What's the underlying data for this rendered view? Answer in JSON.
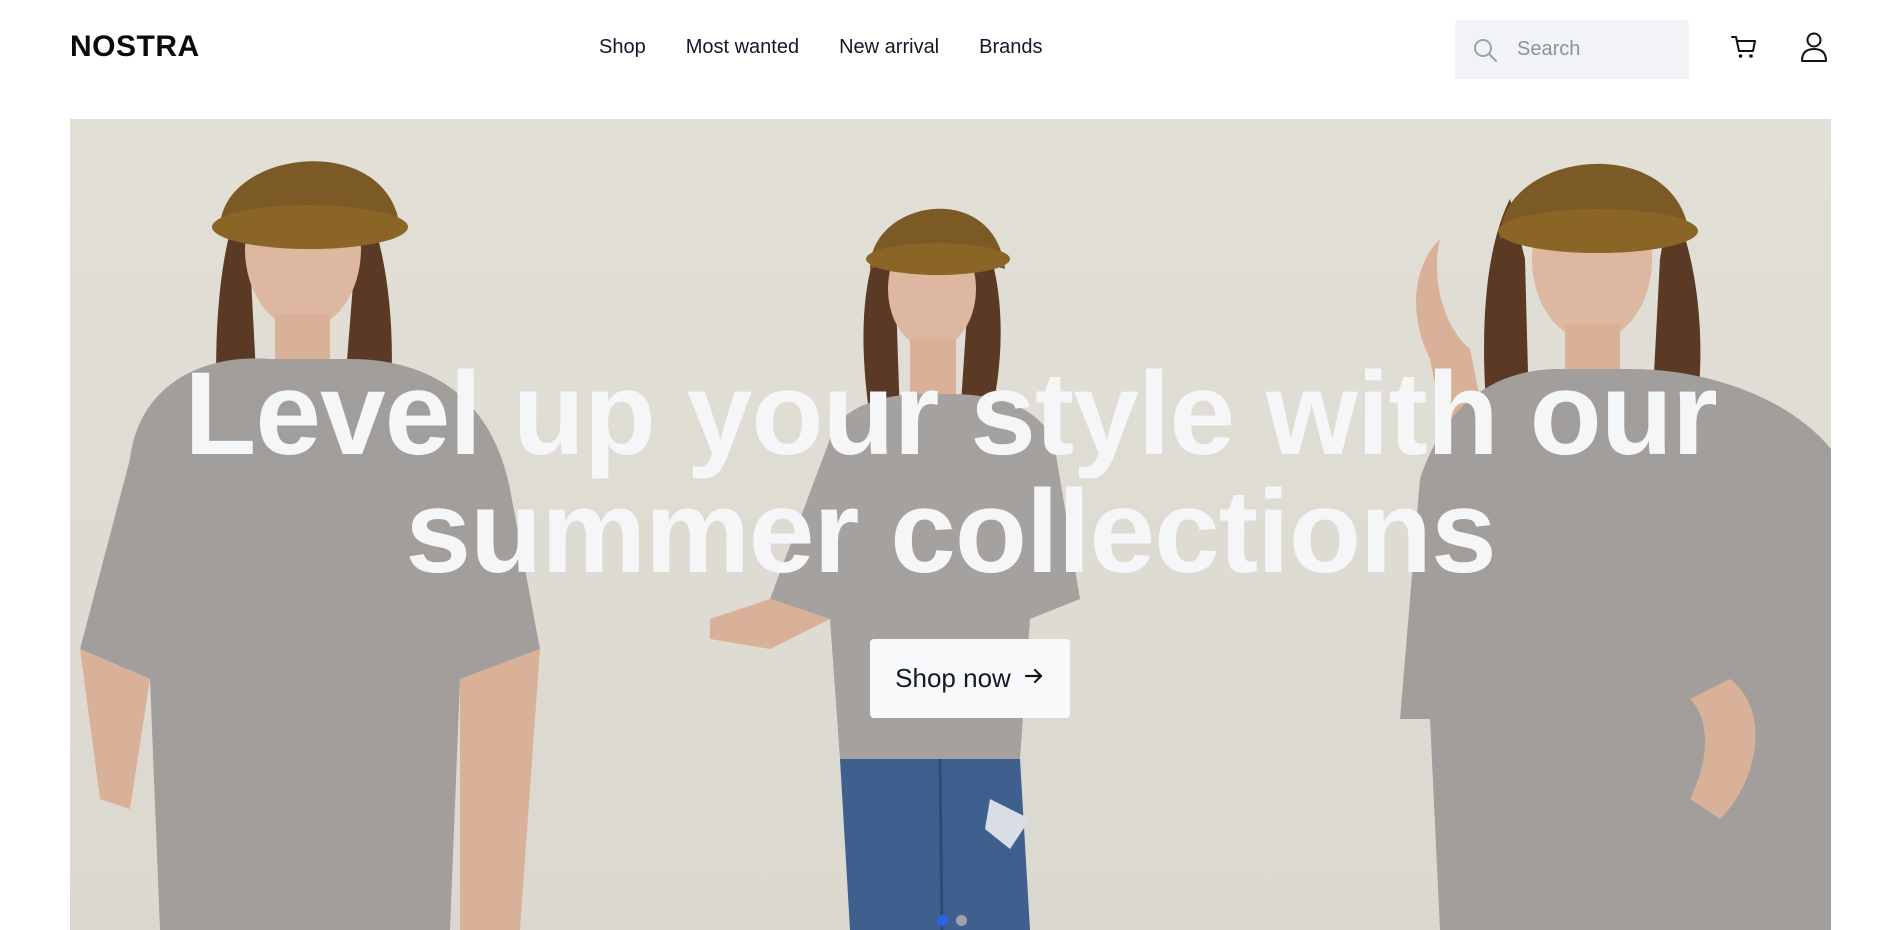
{
  "header": {
    "logo": "NOSTRA",
    "nav": [
      {
        "label": "Shop"
      },
      {
        "label": "Most wanted"
      },
      {
        "label": "New arrival"
      },
      {
        "label": "Brands"
      }
    ],
    "search": {
      "placeholder": "Search",
      "value": "",
      "icon": "search-icon"
    },
    "icons": {
      "cart": "cart-icon",
      "user": "user-icon"
    }
  },
  "hero": {
    "headline_line1": "Level up your style with our",
    "headline_line2": "summer collections",
    "cta_label": "Shop now",
    "cta_icon": "arrow-right-icon",
    "slides": 2,
    "active_slide": 1,
    "image_alt": "three models in grey t-shirts and brown bucket hats"
  },
  "colors": {
    "hero_background": "#dedcd3",
    "headline": "#f5f6f8",
    "active_dot": "#2563eb",
    "search_bg": "#f1f3f7"
  }
}
